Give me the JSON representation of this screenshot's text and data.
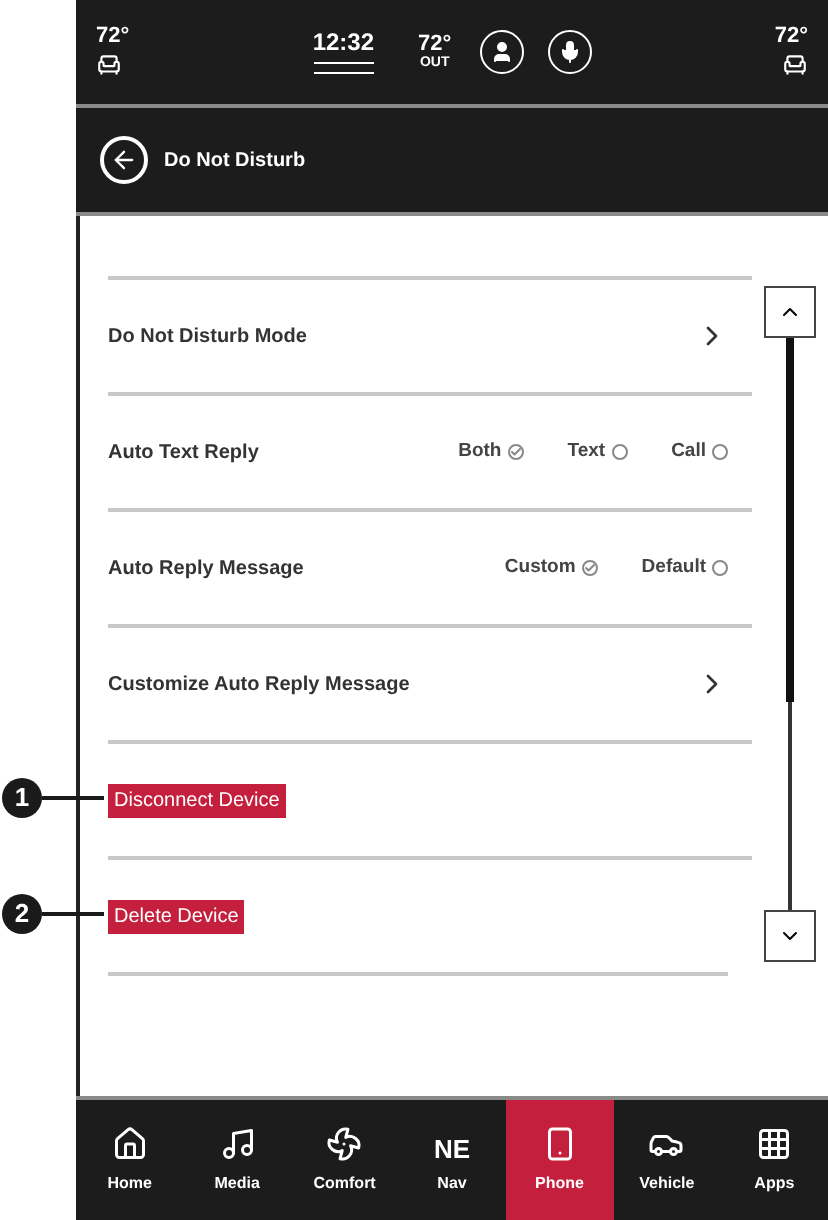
{
  "status_bar": {
    "driver_temp": "72°",
    "clock": "12:32",
    "outside_temp": "72°",
    "outside_label": "OUT",
    "passenger_temp": "72°"
  },
  "header": {
    "title": "Do Not Disturb"
  },
  "rows": [
    {
      "kind": "link",
      "label": "Do Not Disturb Mode"
    },
    {
      "kind": "options",
      "label": "Auto Text Reply",
      "options": [
        {
          "label": "Both",
          "selected": true
        },
        {
          "label": "Text",
          "selected": false
        },
        {
          "label": "Call",
          "selected": false
        }
      ]
    },
    {
      "kind": "options",
      "label": "Auto Reply Message",
      "options": [
        {
          "label": "Custom",
          "selected": true
        },
        {
          "label": "Default",
          "selected": false
        }
      ]
    },
    {
      "kind": "link",
      "label": "Customize Auto Reply Message"
    },
    {
      "kind": "action",
      "label": "Disconnect Device",
      "callout": "1"
    },
    {
      "kind": "action",
      "label": "Delete Device",
      "callout": "2"
    }
  ],
  "nav": [
    {
      "kind": "home",
      "label": "Home",
      "selected": false
    },
    {
      "kind": "media",
      "label": "Media",
      "selected": false
    },
    {
      "kind": "comfort",
      "label": "Comfort",
      "selected": false
    },
    {
      "kind": "compass",
      "label": "Nav",
      "heading": "NE",
      "selected": false
    },
    {
      "kind": "phone",
      "label": "Phone",
      "selected": true
    },
    {
      "kind": "vehicle",
      "label": "Vehicle",
      "selected": false
    },
    {
      "kind": "apps",
      "label": "Apps",
      "selected": false
    }
  ]
}
